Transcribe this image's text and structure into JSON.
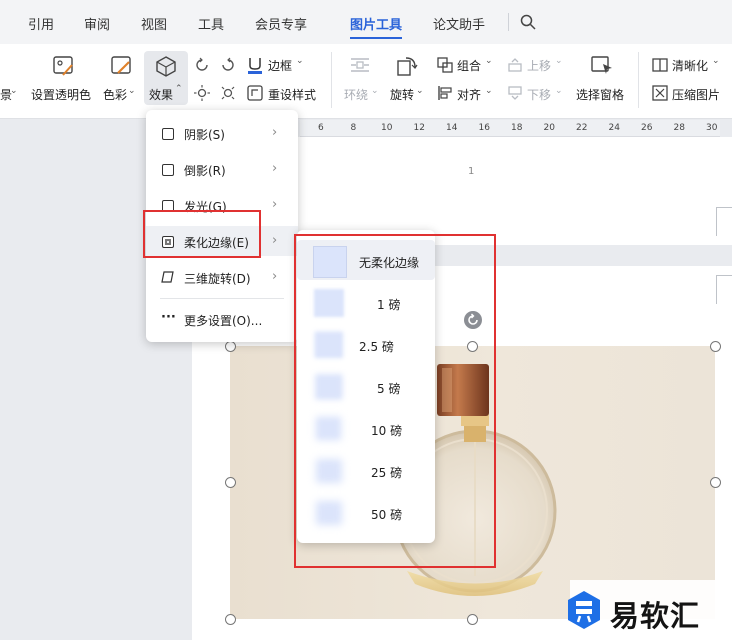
{
  "tabs": [
    {
      "label": "引用"
    },
    {
      "label": "审阅"
    },
    {
      "label": "视图"
    },
    {
      "label": "工具"
    },
    {
      "label": "会员专享"
    },
    {
      "label": "图片工具"
    },
    {
      "label": "论文助手"
    }
  ],
  "active_tab": "图片工具",
  "ribbon": {
    "partial_left_label": "景",
    "set_transparent": "设置透明色",
    "color": "色彩",
    "effects": "效果",
    "border": "边框",
    "reset_style": "重设样式",
    "wrap": "环绕",
    "rotate": "旋转",
    "group": "组合",
    "align": "对齐",
    "bring_forward": "上移",
    "send_backward": "下移",
    "selection_pane": "选择窗格",
    "sharpen": "清晰化",
    "compress": "压缩图片"
  },
  "ruler": [
    "6",
    "8",
    "10",
    "12",
    "14",
    "16",
    "18",
    "20",
    "22",
    "24",
    "26",
    "28",
    "30"
  ],
  "page_number": "1",
  "effects_menu": {
    "items": [
      {
        "label": "阴影(S)"
      },
      {
        "label": "倒影(R)"
      },
      {
        "label": "发光(G)"
      },
      {
        "label": "柔化边缘(E)"
      },
      {
        "label": "三维旋转(D)"
      },
      {
        "label": "更多设置(O)..."
      }
    ]
  },
  "soft_edge_menu": {
    "options": [
      {
        "label": "无柔化边缘",
        "blur": 0
      },
      {
        "label": "1 磅",
        "blur": 1
      },
      {
        "label": "2.5 磅",
        "blur": 2.5
      },
      {
        "label": "5 磅",
        "blur": 5
      },
      {
        "label": "10 磅",
        "blur": 10
      },
      {
        "label": "25 磅",
        "blur": 25
      },
      {
        "label": "50 磅",
        "blur": 50
      }
    ],
    "selected": "无柔化边缘"
  },
  "watermark": {
    "text": "易软汇"
  },
  "colors": {
    "accent": "#2a63d9",
    "highlight_box": "#e03131",
    "swatch": "#dbe4fb"
  }
}
